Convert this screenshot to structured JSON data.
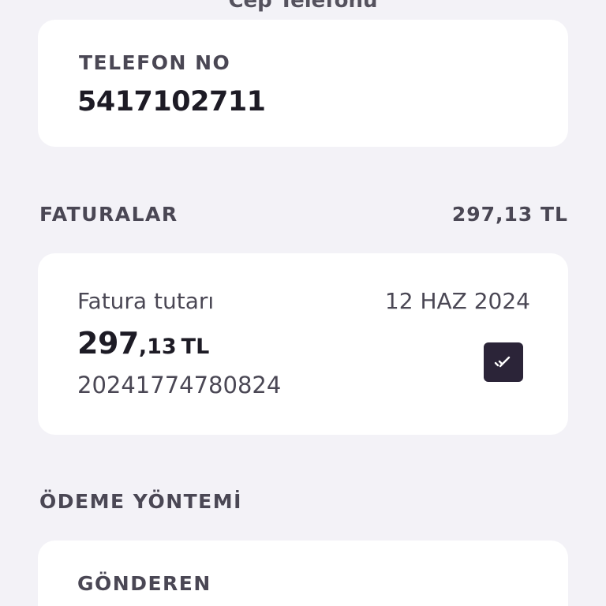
{
  "header": {
    "title": "Cep Telefonu"
  },
  "phone_card": {
    "label": "TELEFON NO",
    "number": "5417102711"
  },
  "invoices_section": {
    "title": "FATURALAR",
    "total": "297,13 TL"
  },
  "invoice": {
    "label": "Fatura tutarı",
    "date": "12 HAZ 2024",
    "amount_main": "297",
    "amount_fraction": ",13",
    "amount_currency": "TL",
    "number": "20241774780824",
    "selected": true,
    "check_icon": "double-check-icon"
  },
  "payment_section": {
    "title": "ÖDEME YÖNTEMİ",
    "sender_label": "GÖNDEREN"
  },
  "colors": {
    "background": "#f3f2f7",
    "card": "#ffffff",
    "checkbox": "#2b2438",
    "text_primary": "#1d1b25",
    "text_secondary": "#4a4754"
  }
}
